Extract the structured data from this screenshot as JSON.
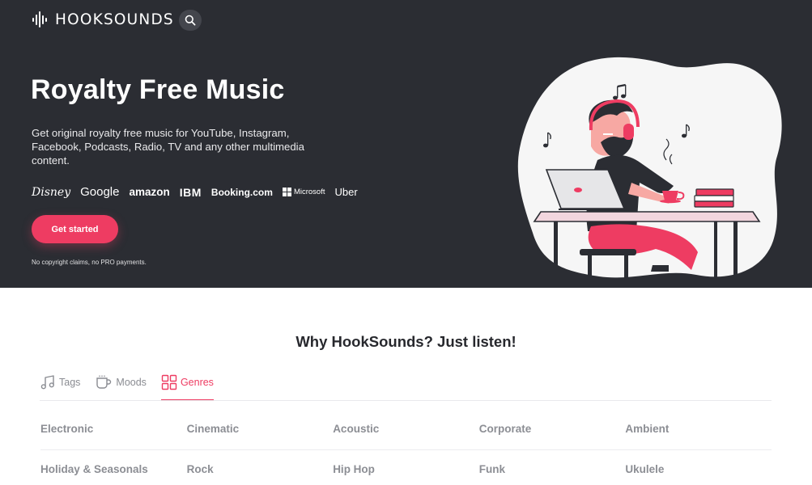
{
  "header": {
    "logo_text": "HOOKSOUNDS",
    "search_icon": "search-icon"
  },
  "hero": {
    "title": "Royalty Free Music",
    "subtitle": "Get original royalty free music for YouTube, Instagram, Facebook, Podcasts, Radio, TV and any other multimedia content.",
    "brands": [
      "Disney",
      "Google",
      "amazon",
      "IBM",
      "Booking.com",
      "Microsoft",
      "Uber"
    ],
    "cta_label": "Get started",
    "note": "No copyright claims, no PRO payments.",
    "illustration_icon": "man-with-headphones-at-laptop-illustration"
  },
  "section": {
    "title": "Why HookSounds? Just listen!",
    "tabs": [
      {
        "label": "Tags",
        "icon": "music-note-icon",
        "active": false
      },
      {
        "label": "Moods",
        "icon": "coffee-cup-icon",
        "active": false
      },
      {
        "label": "Genres",
        "icon": "grid-icon",
        "active": true
      }
    ],
    "genres": [
      [
        "Electronic",
        "Cinematic",
        "Acoustic",
        "Corporate",
        "Ambient"
      ],
      [
        "Holiday & Seasonals",
        "Rock",
        "Hip Hop",
        "Funk",
        "Ukulele"
      ]
    ]
  },
  "colors": {
    "hero_bg": "#2b2d33",
    "accent": "#ee3c62",
    "muted_text": "#8c8e94"
  }
}
